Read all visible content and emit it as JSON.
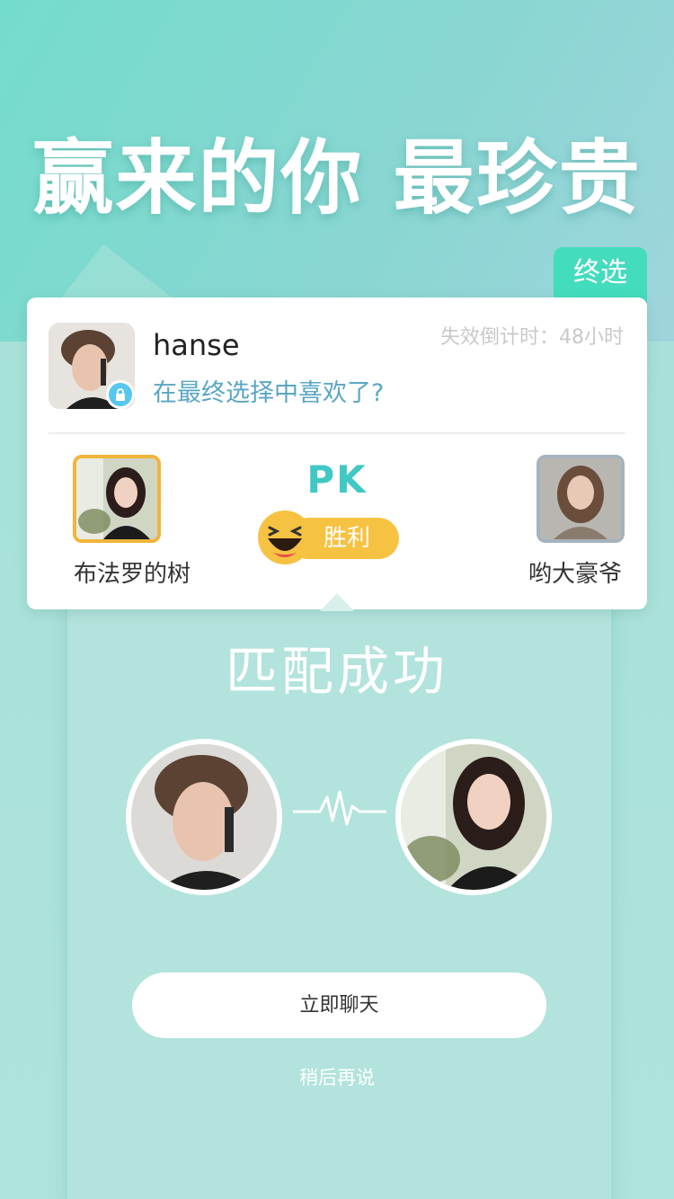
{
  "headline": "赢来的你 最珍贵",
  "badge_final": "终选",
  "card": {
    "name": "hanse",
    "question": "在最终选择中喜欢了?",
    "countdown": "失效倒计时：48小时",
    "pk_label": "PK",
    "win_label": "胜利",
    "candidates": [
      {
        "name": "布法罗的树"
      },
      {
        "name": "哟大豪爷"
      }
    ]
  },
  "match": {
    "title": "匹配成功",
    "chat_button": "立即聊天",
    "later_link": "稍后再说"
  },
  "colors": {
    "accent_green": "#43dcbd",
    "win_yellow": "#f6c242",
    "question_blue": "#5aa6c3",
    "pk_teal": "#3fc8c4"
  }
}
